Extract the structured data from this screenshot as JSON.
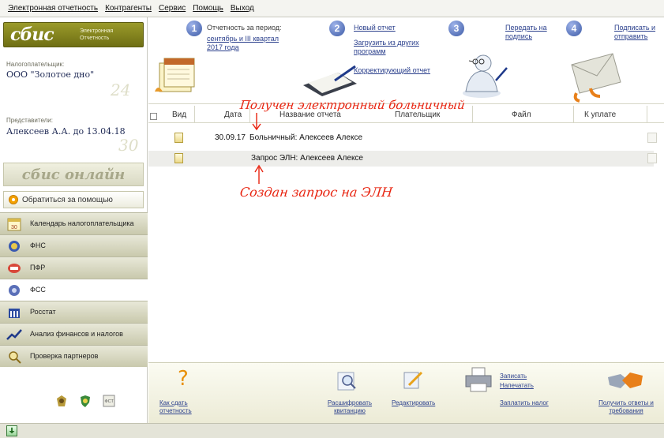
{
  "menu": [
    "Электронная отчетность",
    "Контрагенты",
    "Сервис",
    "Помощь",
    "Выход"
  ],
  "sidebar": {
    "logo_main": "сбис",
    "logo_sub": "Электронная Отчетность",
    "taxpayer_label": "Налогоплательщик:",
    "taxpayer_name": "ООО \"Золотое дно\"",
    "representative_label": "Представители:",
    "representative_name": "Алексеев А.А. до 13.04.18",
    "online_logo": "сбис онлайн",
    "help_button": "Обратиться за помощью",
    "nav": [
      {
        "label": "Календарь налогоплательщика",
        "icon": "calendar-icon"
      },
      {
        "label": "ФНС",
        "icon": "fns-emblem-icon"
      },
      {
        "label": "ПФР",
        "icon": "pfr-emblem-icon"
      },
      {
        "label": "ФСС",
        "icon": "fss-emblem-icon"
      },
      {
        "label": "Росстат",
        "icon": "rosstat-icon"
      },
      {
        "label": "Анализ финансов и налогов",
        "icon": "chart-icon"
      },
      {
        "label": "Проверка партнеров",
        "icon": "magnifier-icon"
      }
    ],
    "badges": [
      "emblem-icon",
      "shield-icon",
      "fst-icon"
    ]
  },
  "steps": {
    "step1": {
      "num": "1",
      "label": "Отчетность за период:",
      "period_line1": "сентябрь и III квартал",
      "period_line2": "2017 года"
    },
    "step2": {
      "num": "2",
      "new_report": "Новый отчет",
      "load_line1": "Загрузить из других",
      "load_line2": "программ",
      "correct_report": "Корректирующий отчет"
    },
    "step3": {
      "num": "3",
      "line1": "Передать на",
      "line2": "подпись"
    },
    "step4": {
      "num": "4",
      "line1": "Подписать и",
      "line2": "отправить"
    }
  },
  "table": {
    "headers": {
      "type": "Вид",
      "date": "Дата",
      "name": "Название отчета",
      "payer": "Плательщик",
      "file": "Файл",
      "pay": "К уплате"
    },
    "rows": [
      {
        "date": "30.09.17",
        "name": "Больничный: Алексеев Алексе"
      },
      {
        "date": "",
        "name": "Запрос ЭЛН: Алексеев Алексе"
      }
    ]
  },
  "annotations": {
    "top": "Получен электронный больничный",
    "bottom": "Создан запрос на ЭЛН"
  },
  "toolbar": {
    "howto_line1": "Как сдать",
    "howto_line2": "отчетность",
    "decode_line1": "Расшифровать",
    "decode_line2": "квитанцию",
    "edit": "Редактировать",
    "write": "Записать",
    "print": "Напечатать",
    "pay_tax": "Заплатить налог",
    "answers_line1": "Получить ответы и",
    "answers_line2": "требования"
  },
  "colors": {
    "accent": "#2a3f8c",
    "annotation": "#e8230f",
    "logo": "#8a8a22"
  }
}
